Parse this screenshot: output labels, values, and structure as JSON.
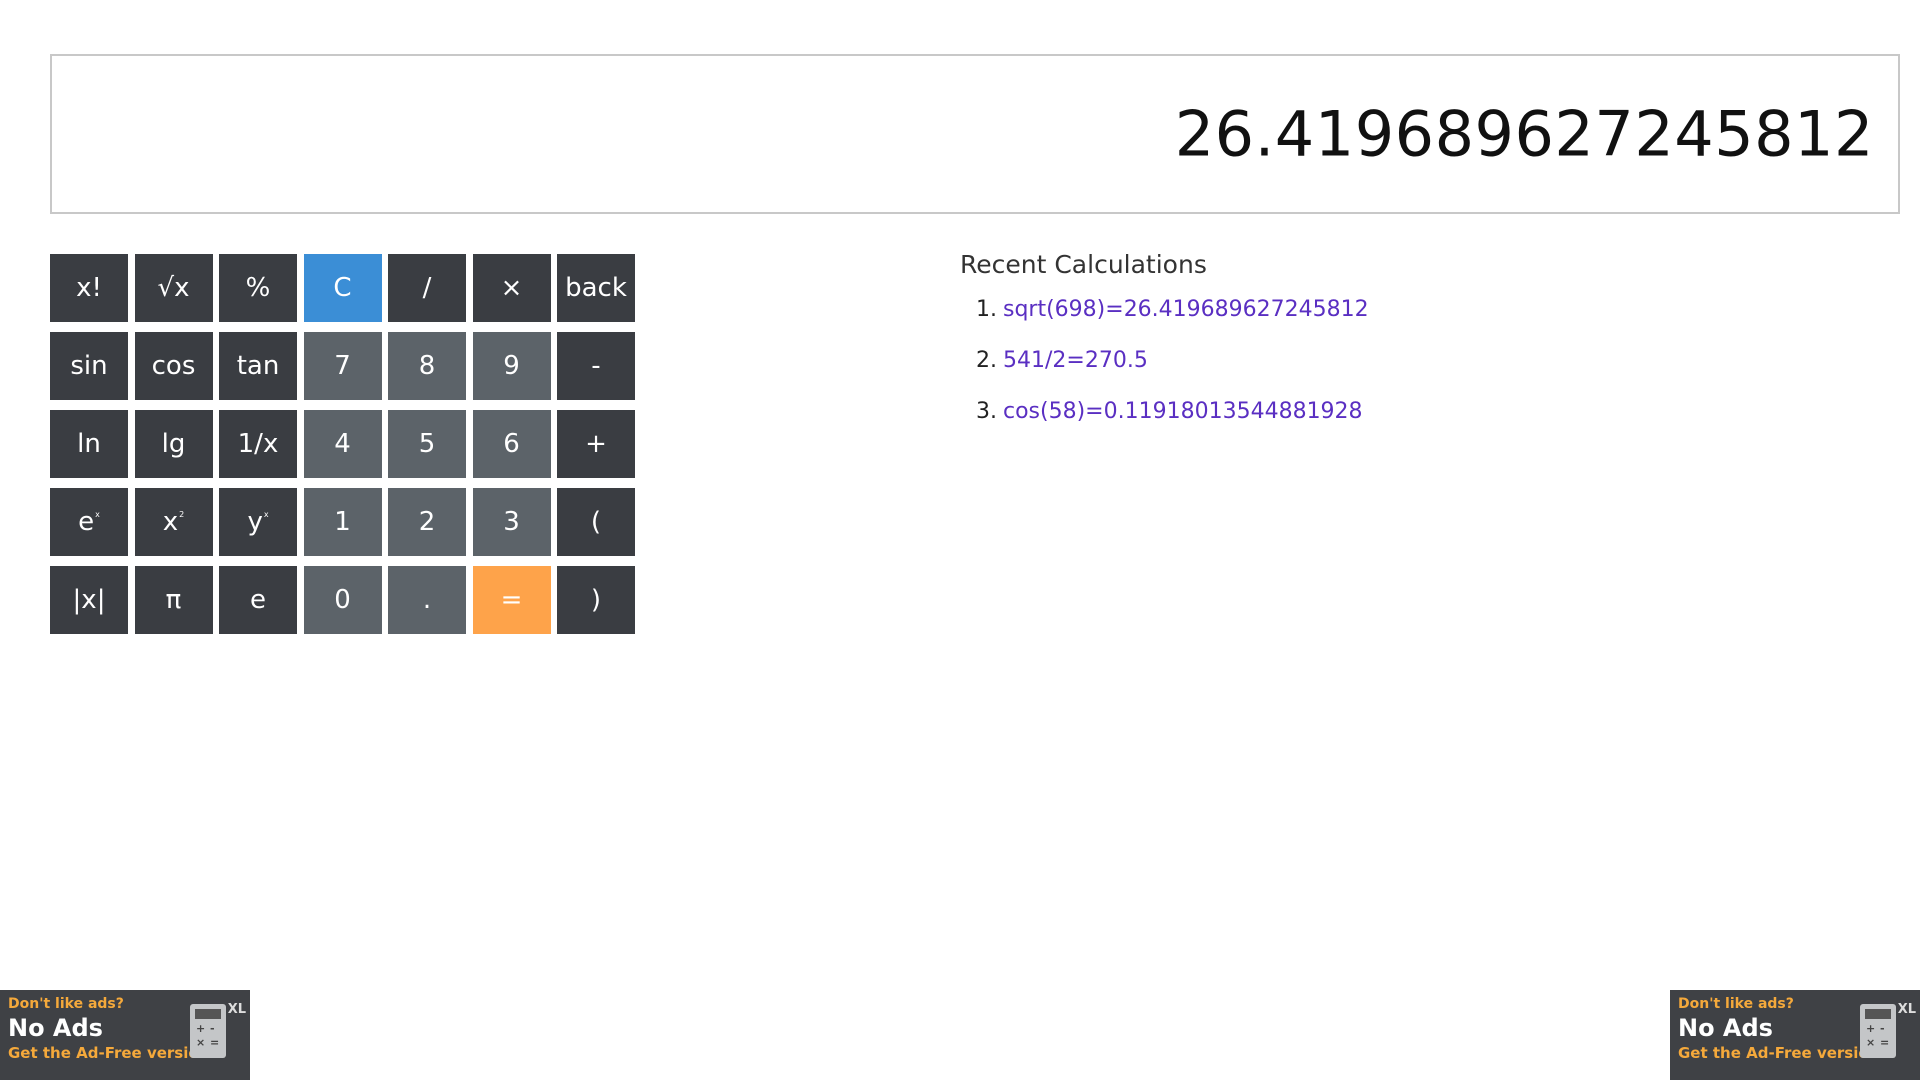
{
  "display": {
    "value": "26.419689627245812"
  },
  "keys": [
    {
      "label": "x!",
      "name": "factorial-button",
      "type": "dark"
    },
    {
      "label": "√x",
      "name": "sqrt-button",
      "type": "dark"
    },
    {
      "label": "%",
      "name": "percent-button",
      "type": "dark"
    },
    {
      "label": "C",
      "name": "clear-button",
      "type": "clear"
    },
    {
      "label": "/",
      "name": "divide-button",
      "type": "dark"
    },
    {
      "label": "×",
      "name": "multiply-button",
      "type": "dark"
    },
    {
      "label": "back",
      "name": "backspace-button",
      "type": "dark"
    },
    {
      "label": "sin",
      "name": "sin-button",
      "type": "dark"
    },
    {
      "label": "cos",
      "name": "cos-button",
      "type": "dark"
    },
    {
      "label": "tan",
      "name": "tan-button",
      "type": "dark"
    },
    {
      "label": "7",
      "name": "digit-7-button",
      "type": "num"
    },
    {
      "label": "8",
      "name": "digit-8-button",
      "type": "num"
    },
    {
      "label": "9",
      "name": "digit-9-button",
      "type": "num"
    },
    {
      "label": "-",
      "name": "subtract-button",
      "type": "dark"
    },
    {
      "label": "ln",
      "name": "ln-button",
      "type": "dark"
    },
    {
      "label": "lg",
      "name": "lg-button",
      "type": "dark"
    },
    {
      "label": "1/x",
      "name": "reciprocal-button",
      "type": "dark"
    },
    {
      "label": "4",
      "name": "digit-4-button",
      "type": "num"
    },
    {
      "label": "5",
      "name": "digit-5-button",
      "type": "num"
    },
    {
      "label": "6",
      "name": "digit-6-button",
      "type": "num"
    },
    {
      "label": "+",
      "name": "add-button",
      "type": "dark"
    },
    {
      "label": "e",
      "sup": "x",
      "name": "exp-button",
      "type": "dark"
    },
    {
      "label": "x",
      "sup": "2",
      "name": "square-button",
      "type": "dark"
    },
    {
      "label": "y",
      "sup": "x",
      "name": "power-button",
      "type": "dark"
    },
    {
      "label": "1",
      "name": "digit-1-button",
      "type": "num"
    },
    {
      "label": "2",
      "name": "digit-2-button",
      "type": "num"
    },
    {
      "label": "3",
      "name": "digit-3-button",
      "type": "num"
    },
    {
      "label": "(",
      "name": "open-paren-button",
      "type": "dark"
    },
    {
      "label": "|x|",
      "name": "abs-button",
      "type": "dark"
    },
    {
      "label": "π",
      "name": "pi-button",
      "type": "dark"
    },
    {
      "label": "e",
      "name": "euler-button",
      "type": "dark"
    },
    {
      "label": "0",
      "name": "digit-0-button",
      "type": "num"
    },
    {
      "label": ".",
      "name": "decimal-button",
      "type": "num"
    },
    {
      "label": "=",
      "name": "equals-button",
      "type": "equals"
    },
    {
      "label": ")",
      "name": "close-paren-button",
      "type": "dark"
    }
  ],
  "recent": {
    "title": "Recent Calculations",
    "items": [
      {
        "num": "1.",
        "text": "sqrt(698)=26.419689627245812"
      },
      {
        "num": "2.",
        "text": "541/2=270.5"
      },
      {
        "num": "3.",
        "text": "cos(58)=0.11918013544881928"
      }
    ]
  },
  "ad": {
    "top": "Don't like ads?",
    "main": "No Ads",
    "bottom": "Get the Ad-Free version!",
    "badge": "XL",
    "icon": "calculator-icon"
  },
  "colors": {
    "dark_key": "#3a3d42",
    "num_key": "#5c6369",
    "clear_key": "#3b8ed6",
    "equals_key": "#fea34a",
    "link": "#5a2fc2",
    "ad_accent": "#f5a93b"
  }
}
